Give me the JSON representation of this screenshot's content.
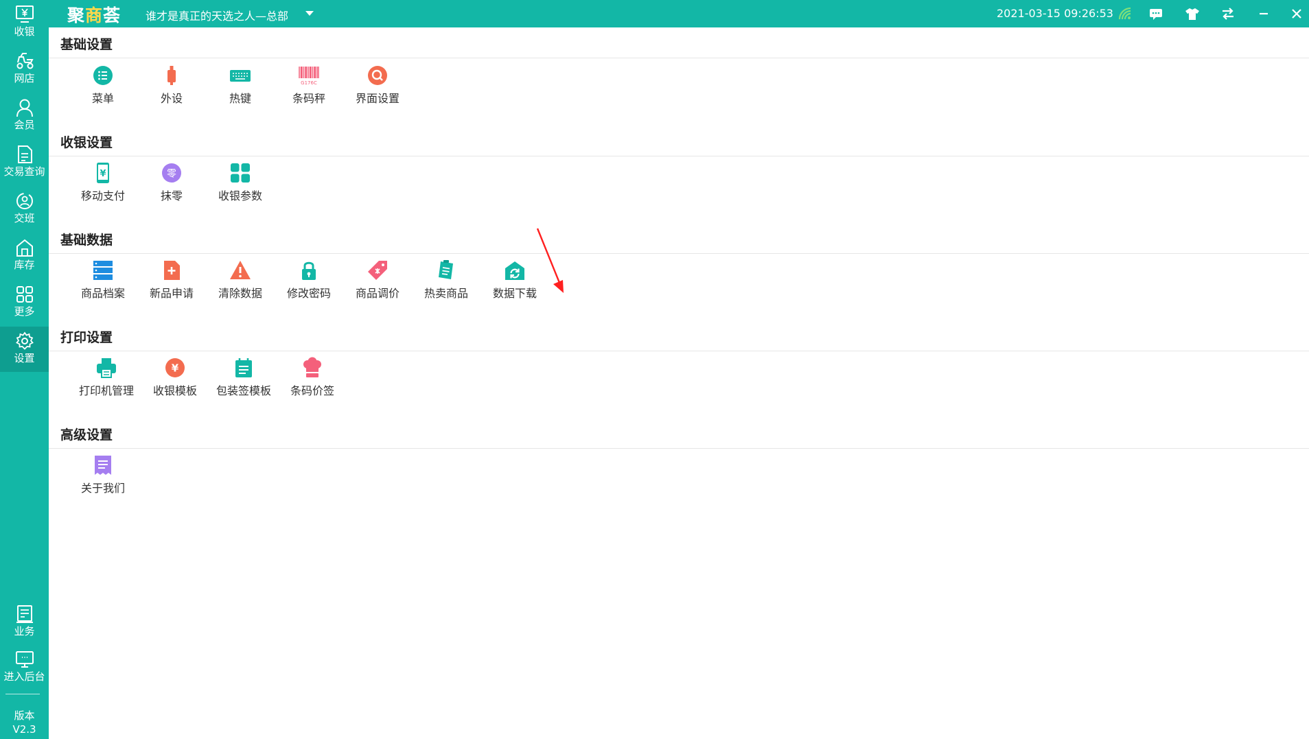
{
  "app": {
    "logo_text_a": "聚",
    "logo_text_b": "商",
    "logo_text_c": "荟",
    "store_name": "谁才是真正的天选之人—总部",
    "datetime": "2021-03-15 09:26:53",
    "brand_color": "#13b7a6"
  },
  "titlebar_icons": [
    "wifi-signal-icon",
    "message-icon",
    "skin-icon",
    "switch-icon",
    "minimize-icon",
    "close-icon"
  ],
  "sidebar": {
    "items": [
      {
        "label": "收银",
        "icon": "cashier-icon"
      },
      {
        "label": "网店",
        "icon": "online-store-icon"
      },
      {
        "label": "会员",
        "icon": "member-icon"
      },
      {
        "label": "交易查询",
        "icon": "transaction-query-icon"
      },
      {
        "label": "交班",
        "icon": "shift-handover-icon"
      },
      {
        "label": "库存",
        "icon": "inventory-icon"
      },
      {
        "label": "更多",
        "icon": "more-icon"
      },
      {
        "label": "设置",
        "icon": "settings-icon",
        "active": true
      }
    ],
    "bottom_items": [
      {
        "label": "业务",
        "icon": "business-icon"
      },
      {
        "label": "进入后台",
        "icon": "backend-icon"
      }
    ],
    "version_label": "版本",
    "version_value": "V2.3"
  },
  "sections": [
    {
      "title": "基础设置",
      "items": [
        {
          "label": "菜单",
          "icon": "menu-list-icon"
        },
        {
          "label": "外设",
          "icon": "peripheral-icon"
        },
        {
          "label": "热键",
          "icon": "keyboard-icon"
        },
        {
          "label": "条码秤",
          "icon": "barcode-scale-icon",
          "icon_text": "G176C"
        },
        {
          "label": "界面设置",
          "icon": "interface-settings-icon"
        }
      ]
    },
    {
      "title": "收银设置",
      "items": [
        {
          "label": "移动支付",
          "icon": "mobile-pay-icon",
          "icon_text": "¥"
        },
        {
          "label": "抹零",
          "icon": "round-off-icon",
          "icon_text": "零"
        },
        {
          "label": "收银参数",
          "icon": "cashier-params-icon"
        }
      ]
    },
    {
      "title": "基础数据",
      "items": [
        {
          "label": "商品档案",
          "icon": "product-archive-icon"
        },
        {
          "label": "新品申请",
          "icon": "new-product-icon"
        },
        {
          "label": "清除数据",
          "icon": "clear-data-warning-icon"
        },
        {
          "label": "修改密码",
          "icon": "change-password-lock-icon"
        },
        {
          "label": "商品调价",
          "icon": "price-adjust-tag-icon"
        },
        {
          "label": "热卖商品",
          "icon": "hot-sale-icon"
        },
        {
          "label": "数据下载",
          "icon": "data-download-icon"
        }
      ]
    },
    {
      "title": "打印设置",
      "items": [
        {
          "label": "打印机管理",
          "icon": "printer-icon"
        },
        {
          "label": "收银模板",
          "icon": "cashier-template-icon",
          "icon_text": "¥"
        },
        {
          "label": "包装签模板",
          "icon": "package-label-icon"
        },
        {
          "label": "条码价签",
          "icon": "barcode-price-tag-icon"
        }
      ]
    },
    {
      "title": "高级设置",
      "items": [
        {
          "label": "关于我们",
          "icon": "about-us-icon"
        }
      ]
    }
  ],
  "colors": {
    "teal": "#13b7a6",
    "orange": "#f36c4f",
    "purple": "#a57ef0",
    "pink": "#f4607b",
    "blue": "#1e8de0",
    "arrow_red": "#ff2020"
  }
}
